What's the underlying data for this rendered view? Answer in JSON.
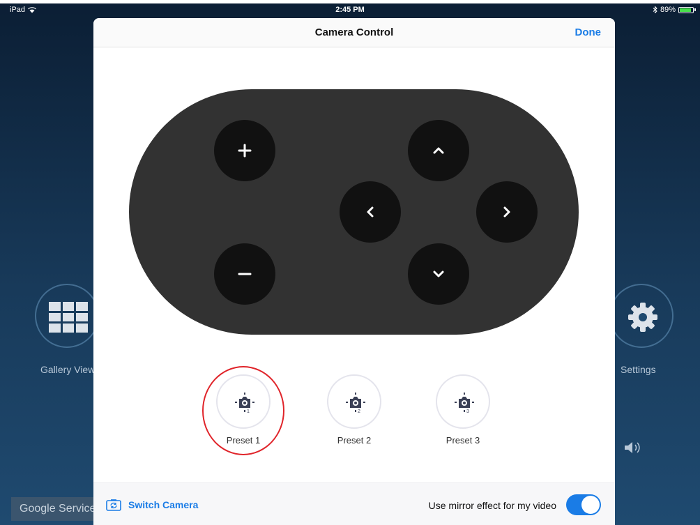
{
  "status_bar": {
    "device": "iPad",
    "time": "2:45 PM",
    "battery": "89%",
    "battery_level": 0.89
  },
  "background": {
    "gallery_label": "Gallery View",
    "settings_label": "Settings",
    "google_label": "Google Services",
    "icons": {
      "gallery": "grid-icon",
      "settings": "gear-icon",
      "speaker": "speaker-icon"
    }
  },
  "modal": {
    "title": "Camera Control",
    "done_label": "Done",
    "controls": {
      "zoom_in": "plus-icon",
      "zoom_out": "minus-icon",
      "up": "chevron-up-icon",
      "down": "chevron-down-icon",
      "left": "chevron-left-icon",
      "right": "chevron-right-icon"
    },
    "presets": [
      {
        "label": "Preset 1",
        "number": "1"
      },
      {
        "label": "Preset 2",
        "number": "2"
      },
      {
        "label": "Preset 3",
        "number": "3"
      }
    ],
    "footer": {
      "switch_camera_label": "Switch Camera",
      "mirror_label": "Use mirror effect for my video",
      "mirror_enabled": true
    }
  },
  "colors": {
    "accent": "#1a7ce6",
    "highlight": "#e0242a",
    "pad": "#323232",
    "button": "#111111"
  }
}
